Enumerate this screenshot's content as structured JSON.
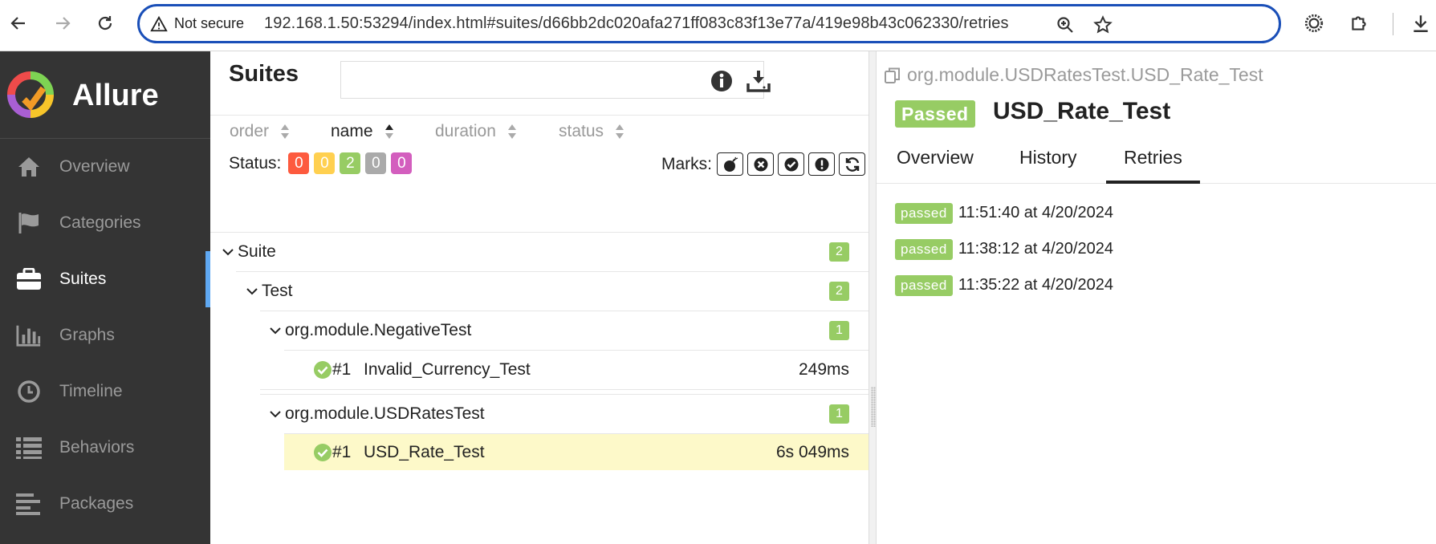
{
  "browser": {
    "security_label": "Not secure",
    "url": "192.168.1.50:53294/index.html#suites/d66bb2dc020afa271ff083c83f13e77a/419e98b43c062330/retries",
    "accent_color": "#1a4fb8"
  },
  "sidebar": {
    "brand": "Allure",
    "items": [
      {
        "label": "Overview",
        "icon": "home-icon",
        "active": false
      },
      {
        "label": "Categories",
        "icon": "flag-icon",
        "active": false
      },
      {
        "label": "Suites",
        "icon": "briefcase-icon",
        "active": true
      },
      {
        "label": "Graphs",
        "icon": "bar-chart-icon",
        "active": false
      },
      {
        "label": "Timeline",
        "icon": "clock-icon",
        "active": false
      },
      {
        "label": "Behaviors",
        "icon": "list-icon",
        "active": false
      },
      {
        "label": "Packages",
        "icon": "align-left-icon",
        "active": false
      }
    ],
    "active_color": "#5fa8f2"
  },
  "suites": {
    "title": "Suites",
    "sort": [
      {
        "label": "order",
        "active": false
      },
      {
        "label": "name",
        "active": true
      },
      {
        "label": "duration",
        "active": false
      },
      {
        "label": "status",
        "active": false
      }
    ],
    "status_label": "Status:",
    "status_counts": [
      {
        "name": "failed",
        "value": "0",
        "color": "#fd5a3e"
      },
      {
        "name": "broken",
        "value": "0",
        "color": "#ffd050"
      },
      {
        "name": "passed",
        "value": "2",
        "color": "#97cc64"
      },
      {
        "name": "skipped",
        "value": "0",
        "color": "#aaaaaa"
      },
      {
        "name": "unknown",
        "value": "0",
        "color": "#d35ebe"
      }
    ],
    "marks_label": "Marks:",
    "tree": {
      "suite": {
        "label": "Suite",
        "count": "2"
      },
      "test": {
        "label": "Test",
        "count": "2"
      },
      "groups": [
        {
          "label": "org.module.NegativeTest",
          "count": "1",
          "cases": [
            {
              "num": "#1",
              "name": "Invalid_Currency_Test",
              "duration": "249ms",
              "selected": false
            }
          ]
        },
        {
          "label": "org.module.USDRatesTest",
          "count": "1",
          "cases": [
            {
              "num": "#1",
              "name": "USD_Rate_Test",
              "duration": "6s 049ms",
              "selected": true
            }
          ]
        }
      ]
    }
  },
  "detail": {
    "breadcrumb": "org.module.USDRatesTest.USD_Rate_Test",
    "status": "Passed",
    "title": "USD_Rate_Test",
    "tabs": [
      {
        "label": "Overview",
        "active": false
      },
      {
        "label": "History",
        "active": false
      },
      {
        "label": "Retries",
        "active": true
      }
    ],
    "retries": [
      {
        "status": "passed",
        "time": "11:51:40 at 4/20/2024"
      },
      {
        "status": "passed",
        "time": "11:38:12 at 4/20/2024"
      },
      {
        "status": "passed",
        "time": "11:35:22 at 4/20/2024"
      }
    ]
  }
}
